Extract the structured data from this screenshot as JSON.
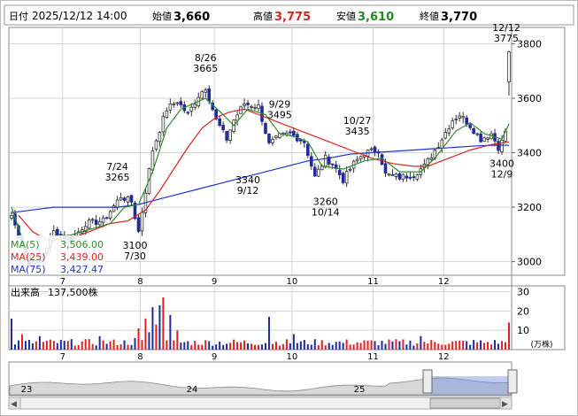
{
  "header": {
    "date_label": "日付",
    "datetime": "2025/12/12 14:00",
    "open_label": "始値",
    "open": "3,660",
    "high_label": "高値",
    "high": "3,775",
    "low_label": "安値",
    "low": "3,610",
    "close_label": "終値",
    "close": "3,770"
  },
  "ma_legend": [
    {
      "label": "MA(5)",
      "value": "3,506.00",
      "color": "#2e8b2e"
    },
    {
      "label": "MA(25)",
      "value": "3,439.00",
      "color": "#dd2222"
    },
    {
      "label": "MA(75)",
      "value": "3,427.47",
      "color": "#2233cc"
    }
  ],
  "volume_legend": {
    "label": "出来高",
    "value": "137,500株"
  },
  "volume_unit": "(万株)",
  "colors": {
    "up": "#ffffff",
    "down": "#1f2a9e",
    "vol_up": "#e02020",
    "vol_down": "#1f2a9e",
    "ma5": "#2e8b2e",
    "ma25": "#dd2222",
    "ma75": "#2233cc",
    "grid": "#d3d3d3"
  },
  "chart_data": [
    {
      "type": "candlestick",
      "x_ticks": [
        "7",
        "8",
        "9",
        "10",
        "11",
        "12"
      ],
      "y_ticks": [
        3000,
        3200,
        3400,
        3600,
        3800
      ],
      "ylim": [
        2950,
        3860
      ],
      "annotations": [
        {
          "date": "7/30",
          "price": 3100,
          "position": "below"
        },
        {
          "date": "7/24",
          "price": 3265,
          "position": "above"
        },
        {
          "date": "8/26",
          "price": 3665,
          "position": "above"
        },
        {
          "date": "9/12",
          "price": 3340,
          "position": "below"
        },
        {
          "date": "9/29",
          "price": 3495,
          "position": "above"
        },
        {
          "date": "10/14",
          "price": 3260,
          "position": "below"
        },
        {
          "date": "10/27",
          "price": 3435,
          "position": "above"
        },
        {
          "date": "12/9",
          "price": 3400,
          "position": "below"
        },
        {
          "date": "12/12",
          "price": 3775,
          "position": "above"
        }
      ],
      "anchors": [
        {
          "i": 0,
          "p": 3170
        },
        {
          "i": 5,
          "p": 2985
        },
        {
          "i": 8,
          "p": 3000
        },
        {
          "i": 12,
          "p": 3110
        },
        {
          "i": 17,
          "p": 3080
        },
        {
          "i": 21,
          "p": 3140
        },
        {
          "i": 26,
          "p": 3150
        },
        {
          "i": 31,
          "p": 3240
        },
        {
          "i": 34,
          "p": 3220
        },
        {
          "i": 36,
          "p": 3110
        },
        {
          "i": 40,
          "p": 3410
        },
        {
          "i": 44,
          "p": 3560
        },
        {
          "i": 47,
          "p": 3590
        },
        {
          "i": 50,
          "p": 3540
        },
        {
          "i": 53,
          "p": 3610
        },
        {
          "i": 55,
          "p": 3640
        },
        {
          "i": 58,
          "p": 3520
        },
        {
          "i": 61,
          "p": 3450
        },
        {
          "i": 63,
          "p": 3520
        },
        {
          "i": 66,
          "p": 3580
        },
        {
          "i": 70,
          "p": 3570
        },
        {
          "i": 73,
          "p": 3430
        },
        {
          "i": 76,
          "p": 3460
        },
        {
          "i": 79,
          "p": 3470
        },
        {
          "i": 83,
          "p": 3440
        },
        {
          "i": 86,
          "p": 3310
        },
        {
          "i": 89,
          "p": 3380
        },
        {
          "i": 91,
          "p": 3360
        },
        {
          "i": 94,
          "p": 3300
        },
        {
          "i": 97,
          "p": 3360
        },
        {
          "i": 100,
          "p": 3400
        },
        {
          "i": 104,
          "p": 3410
        },
        {
          "i": 106,
          "p": 3320
        },
        {
          "i": 110,
          "p": 3310
        },
        {
          "i": 114,
          "p": 3320
        },
        {
          "i": 117,
          "p": 3350
        },
        {
          "i": 121,
          "p": 3430
        },
        {
          "i": 125,
          "p": 3520
        },
        {
          "i": 127,
          "p": 3540
        },
        {
          "i": 130,
          "p": 3500
        },
        {
          "i": 133,
          "p": 3450
        },
        {
          "i": 136,
          "p": 3470
        },
        {
          "i": 138,
          "p": 3420
        },
        {
          "i": 139,
          "p": 3440
        },
        {
          "i": 140,
          "p": 3480
        },
        {
          "i": 141,
          "p": 3770
        }
      ],
      "ma5": [
        [
          0,
          3200
        ],
        [
          5,
          3010
        ],
        [
          8,
          2990
        ],
        [
          12,
          3080
        ],
        [
          20,
          3110
        ],
        [
          28,
          3140
        ],
        [
          32,
          3200
        ],
        [
          36,
          3210
        ],
        [
          40,
          3330
        ],
        [
          44,
          3490
        ],
        [
          48,
          3560
        ],
        [
          55,
          3600
        ],
        [
          60,
          3540
        ],
        [
          63,
          3500
        ],
        [
          67,
          3560
        ],
        [
          72,
          3540
        ],
        [
          76,
          3470
        ],
        [
          80,
          3460
        ],
        [
          84,
          3440
        ],
        [
          88,
          3350
        ],
        [
          94,
          3340
        ],
        [
          100,
          3370
        ],
        [
          105,
          3380
        ],
        [
          110,
          3330
        ],
        [
          116,
          3330
        ],
        [
          120,
          3380
        ],
        [
          126,
          3480
        ],
        [
          130,
          3510
        ],
        [
          134,
          3470
        ],
        [
          139,
          3450
        ],
        [
          141,
          3506
        ]
      ],
      "ma25": [
        [
          2,
          3170
        ],
        [
          6,
          3110
        ],
        [
          10,
          3080
        ],
        [
          16,
          3080
        ],
        [
          22,
          3110
        ],
        [
          28,
          3140
        ],
        [
          33,
          3150
        ],
        [
          38,
          3190
        ],
        [
          42,
          3260
        ],
        [
          46,
          3340
        ],
        [
          50,
          3420
        ],
        [
          54,
          3490
        ],
        [
          58,
          3530
        ],
        [
          62,
          3550
        ],
        [
          66,
          3560
        ],
        [
          70,
          3540
        ],
        [
          74,
          3520
        ],
        [
          78,
          3500
        ],
        [
          82,
          3480
        ],
        [
          86,
          3460
        ],
        [
          90,
          3440
        ],
        [
          96,
          3410
        ],
        [
          102,
          3380
        ],
        [
          108,
          3360
        ],
        [
          114,
          3350
        ],
        [
          118,
          3350
        ],
        [
          124,
          3380
        ],
        [
          130,
          3410
        ],
        [
          136,
          3430
        ],
        [
          141,
          3439
        ]
      ],
      "ma75": [
        [
          0,
          3180
        ],
        [
          6,
          3190
        ],
        [
          12,
          3200
        ],
        [
          18,
          3200
        ],
        [
          24,
          3200
        ],
        [
          30,
          3200
        ],
        [
          36,
          3210
        ],
        [
          42,
          3230
        ],
        [
          48,
          3250
        ],
        [
          54,
          3270
        ],
        [
          60,
          3290
        ],
        [
          66,
          3310
        ],
        [
          72,
          3330
        ],
        [
          78,
          3350
        ],
        [
          84,
          3370
        ],
        [
          90,
          3380
        ],
        [
          96,
          3395
        ],
        [
          102,
          3400
        ],
        [
          108,
          3405
        ],
        [
          114,
          3410
        ],
        [
          120,
          3415
        ],
        [
          126,
          3420
        ],
        [
          132,
          3425
        ],
        [
          138,
          3428
        ],
        [
          141,
          3427
        ]
      ]
    },
    {
      "type": "bar",
      "name": "volume",
      "unit": "万株",
      "y_ticks": [
        10,
        20,
        30
      ],
      "ylim": [
        0,
        33
      ],
      "spikes": [
        {
          "i": 0,
          "v": 16,
          "up": false
        },
        {
          "i": 3,
          "v": 8,
          "up": true
        },
        {
          "i": 8,
          "v": 7,
          "up": false
        },
        {
          "i": 25,
          "v": 7,
          "up": false
        },
        {
          "i": 35,
          "v": 6,
          "up": false
        },
        {
          "i": 36,
          "v": 11,
          "up": true
        },
        {
          "i": 38,
          "v": 16,
          "up": true
        },
        {
          "i": 39,
          "v": 9,
          "up": false
        },
        {
          "i": 40,
          "v": 22,
          "up": false
        },
        {
          "i": 41,
          "v": 13,
          "up": true
        },
        {
          "i": 42,
          "v": 23,
          "up": false
        },
        {
          "i": 43,
          "v": 27,
          "up": true
        },
        {
          "i": 45,
          "v": 18,
          "up": false
        },
        {
          "i": 47,
          "v": 10,
          "up": true
        },
        {
          "i": 73,
          "v": 17,
          "up": false
        },
        {
          "i": 80,
          "v": 8,
          "up": false
        },
        {
          "i": 116,
          "v": 7,
          "up": false
        },
        {
          "i": 141,
          "v": 14,
          "up": true
        }
      ]
    }
  ],
  "overview": {
    "labels": [
      "23",
      "24",
      "25"
    ]
  },
  "scrollbar": {
    "left_arrow": "◀",
    "right_arrow": "▶"
  }
}
